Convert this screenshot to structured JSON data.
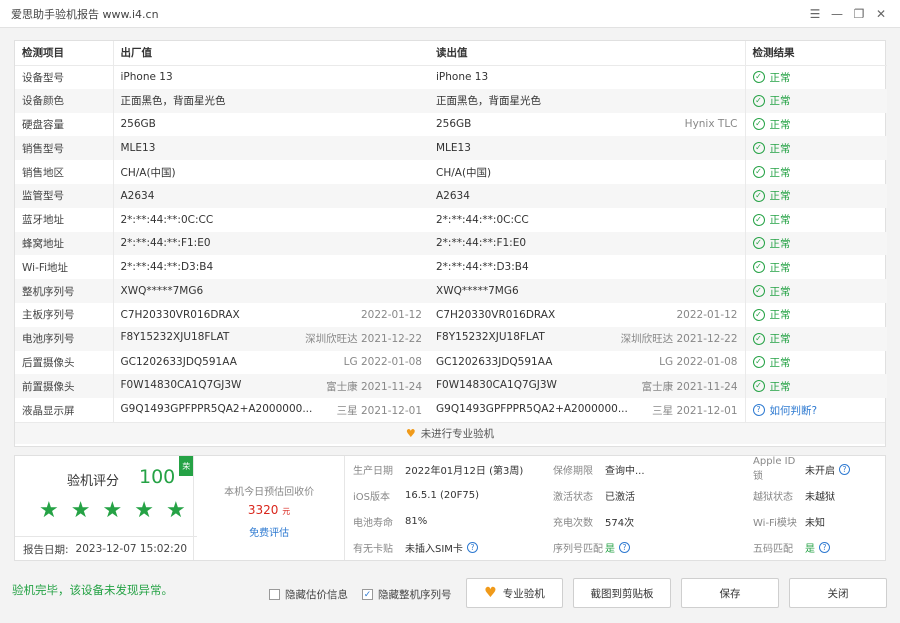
{
  "window": {
    "title": "爱思助手验机报告 www.i4.cn"
  },
  "table": {
    "headers": [
      "检测项目",
      "出厂值",
      "读出值",
      "检测结果"
    ],
    "rows": [
      {
        "item": "设备型号",
        "factory": "iPhone 13",
        "factory_note": "",
        "read": "iPhone 13",
        "read_note": "",
        "result": "正常",
        "status": "ok"
      },
      {
        "item": "设备颜色",
        "factory": "正面黑色，背面星光色",
        "factory_note": "",
        "read": "正面黑色，背面星光色",
        "read_note": "",
        "result": "正常",
        "status": "ok"
      },
      {
        "item": "硬盘容量",
        "factory": "256GB",
        "factory_note": "",
        "read": "256GB",
        "read_note": "Hynix TLC",
        "result": "正常",
        "status": "ok"
      },
      {
        "item": "销售型号",
        "factory": "MLE13",
        "factory_note": "",
        "read": "MLE13",
        "read_note": "",
        "result": "正常",
        "status": "ok"
      },
      {
        "item": "销售地区",
        "factory": "CH/A(中国)",
        "factory_note": "",
        "read": "CH/A(中国)",
        "read_note": "",
        "result": "正常",
        "status": "ok"
      },
      {
        "item": "监管型号",
        "factory": "A2634",
        "factory_note": "",
        "read": "A2634",
        "read_note": "",
        "result": "正常",
        "status": "ok"
      },
      {
        "item": "蓝牙地址",
        "factory": "2*:**:44:**:0C:CC",
        "factory_note": "",
        "read": "2*:**:44:**:0C:CC",
        "read_note": "",
        "result": "正常",
        "status": "ok"
      },
      {
        "item": "蜂窝地址",
        "factory": "2*:**:44:**:F1:E0",
        "factory_note": "",
        "read": "2*:**:44:**:F1:E0",
        "read_note": "",
        "result": "正常",
        "status": "ok"
      },
      {
        "item": "Wi-Fi地址",
        "factory": "2*:**:44:**:D3:B4",
        "factory_note": "",
        "read": "2*:**:44:**:D3:B4",
        "read_note": "",
        "result": "正常",
        "status": "ok"
      },
      {
        "item": "整机序列号",
        "factory": "XWQ*****7MG6",
        "factory_note": "",
        "read": "XWQ*****7MG6",
        "read_note": "",
        "result": "正常",
        "status": "ok"
      },
      {
        "item": "主板序列号",
        "factory": "C7H20330VR016DRAX",
        "factory_note": "2022-01-12",
        "read": "C7H20330VR016DRAX",
        "read_note": "2022-01-12",
        "result": "正常",
        "status": "ok"
      },
      {
        "item": "电池序列号",
        "factory": "F8Y15232XJU18FLAT",
        "factory_note": "深圳欣旺达 2021-12-22",
        "read": "F8Y15232XJU18FLAT",
        "read_note": "深圳欣旺达 2021-12-22",
        "result": "正常",
        "status": "ok"
      },
      {
        "item": "后置摄像头",
        "factory": "GC1202633JDQ591AA",
        "factory_note": "LG 2022-01-08",
        "read": "GC1202633JDQ591AA",
        "read_note": "LG 2022-01-08",
        "result": "正常",
        "status": "ok"
      },
      {
        "item": "前置摄像头",
        "factory": "F0W14830CA1Q7GJ3W",
        "factory_note": "富士康 2021-11-24",
        "read": "F0W14830CA1Q7GJ3W",
        "read_note": "富士康 2021-11-24",
        "result": "正常",
        "status": "ok"
      },
      {
        "item": "液晶显示屏",
        "factory": "G9Q1493GPFPPR5QA2+A2000000...",
        "factory_note": "三星 2021-12-01",
        "read": "G9Q1493GPFPPR5QA2+A2000000...",
        "read_note": "三星 2021-12-01",
        "result": "如何判断?",
        "status": "help"
      }
    ],
    "footer": "未进行专业验机"
  },
  "score": {
    "label": "验机评分",
    "value": "100",
    "badge": "荣",
    "stars": 5,
    "date_label": "报告日期:",
    "date_value": "2023-12-07 15:02:20"
  },
  "estimate": {
    "title": "本机今日预估回收价",
    "price": "3320",
    "unit": "元",
    "link": "免费评估"
  },
  "info": [
    {
      "k": "生产日期",
      "v": "2022年01月12日 (第3周)",
      "style": "",
      "help": false
    },
    {
      "k": "保修期限",
      "v": "查询中...",
      "style": "",
      "help": false
    },
    {
      "k": "Apple ID锁",
      "v": "未开启",
      "style": "",
      "help": true
    },
    {
      "k": "iOS版本",
      "v": "16.5.1 (20F75)",
      "style": "",
      "help": false
    },
    {
      "k": "激活状态",
      "v": "已激活",
      "style": "",
      "help": false
    },
    {
      "k": "越狱状态",
      "v": "未越狱",
      "style": "",
      "help": false
    },
    {
      "k": "电池寿命",
      "v": "81%",
      "style": "",
      "help": false
    },
    {
      "k": "充电次数",
      "v": "574次",
      "style": "",
      "help": false
    },
    {
      "k": "Wi-Fi模块",
      "v": "未知",
      "style": "",
      "help": false
    },
    {
      "k": "有无卡贴",
      "v": "未插入SIM卡",
      "style": "",
      "help": true
    },
    {
      "k": "序列号匹配",
      "v": "是",
      "style": "green",
      "help": true
    },
    {
      "k": "五码匹配",
      "v": "是",
      "style": "green",
      "help": true
    }
  ],
  "bottom": {
    "status": "验机完毕，该设备未发现异常。",
    "hide_price": "隐藏估价信息",
    "hide_price_checked": false,
    "hide_serial": "隐藏整机序列号",
    "hide_serial_checked": true,
    "pro_btn": "专业验机",
    "copy_btn": "截图到剪贴板",
    "save_btn": "保存",
    "close_btn": "关闭"
  },
  "colors": {
    "green": "#25a245",
    "blue": "#2e7ad1",
    "red": "#d9261c",
    "orange": "#f09a1a"
  }
}
